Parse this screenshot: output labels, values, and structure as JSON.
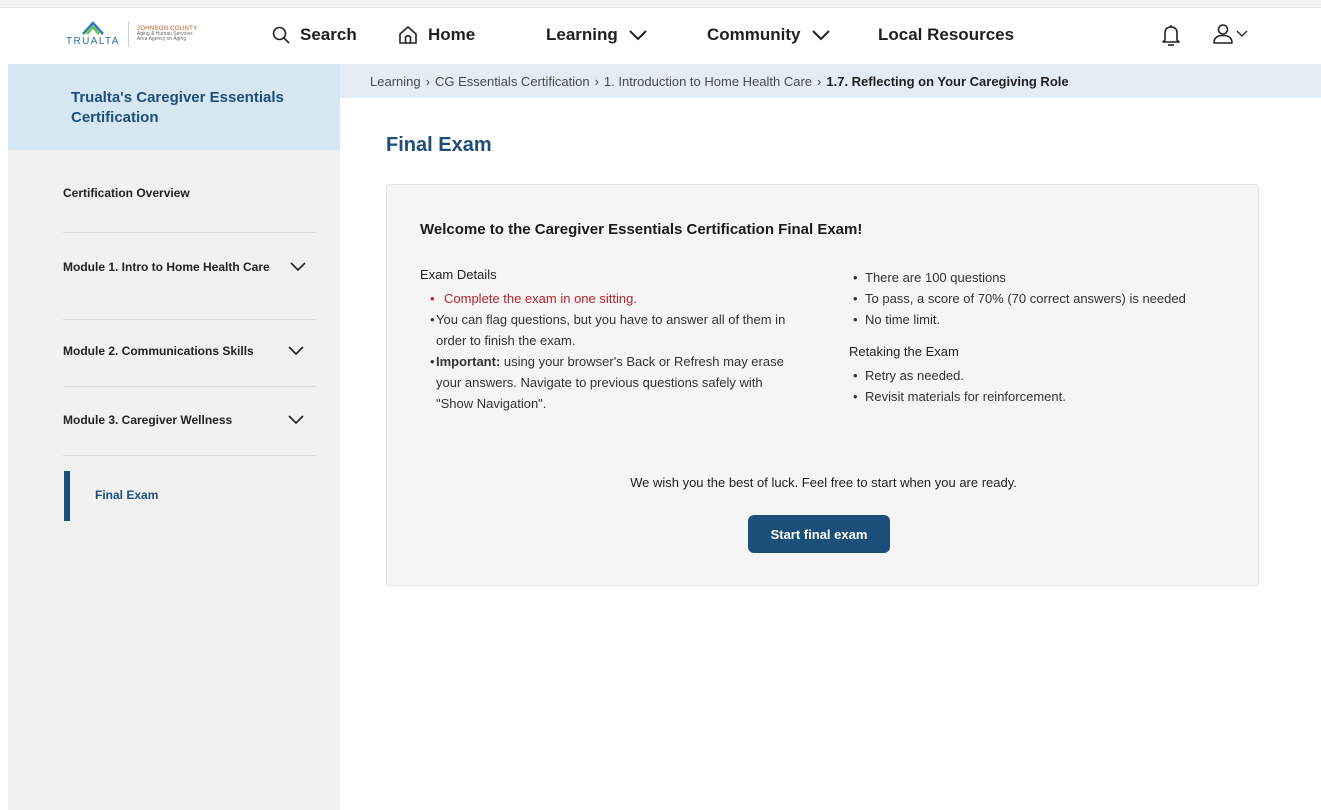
{
  "header": {
    "logo_text": "TRUALTA",
    "county_line1": "JOHNSON COUNTY",
    "county_line2": "Aging & Human Services",
    "county_line3": "Area Agency on Aging",
    "nav": {
      "search": "Search",
      "home": "Home",
      "learning": "Learning",
      "community": "Community",
      "local_resources": "Local Resources"
    }
  },
  "sidebar": {
    "title": "Trualta's Caregiver Essentials Certification",
    "items": [
      {
        "label": "Certification Overview"
      },
      {
        "label": "Module 1. Intro to Home Health Care"
      },
      {
        "label": "Module 2. Communications Skills"
      },
      {
        "label": "Module 3. Caregiver Wellness"
      }
    ],
    "active": "Final Exam"
  },
  "breadcrumb": {
    "items": [
      "Learning",
      "CG Essentials Certification",
      "1. Introduction to Home Health Care"
    ],
    "current": "1.7. Reflecting on Your Caregiving Role"
  },
  "main": {
    "title": "Final Exam",
    "card": {
      "heading": "Welcome to the Caregiver Essentials Certification Final Exam!",
      "exam_details_label": "Exam Details",
      "details": {
        "one_sitting": "Complete the exam in one sitting.",
        "flag": "You can flag questions, but you have to answer all of them in order to finish the exam.",
        "important_label": "Important:",
        "important_text": " using your browser's Back or Refresh may erase your answers. Navigate to previous questions safely with \"Show Navigation\"."
      },
      "right_items": [
        "There are 100 questions",
        "To pass, a score of 70% (70 correct answers) is needed",
        "No time limit."
      ],
      "retaking_label": "Retaking the Exam",
      "retaking_items": [
        "Retry as needed.",
        "Revisit materials for reinforcement."
      ],
      "luck": "We wish you the best of luck. Feel free to start when you are ready.",
      "start_button": "Start final exam"
    }
  },
  "icons": {
    "search": "search-icon",
    "home": "home-icon",
    "chevron": "chevron-down-icon",
    "bell": "bell-icon",
    "user": "user-icon"
  },
  "colors": {
    "brand_blue": "#1d4e79",
    "sidebar_header": "#d6e7f4",
    "breadcrumb_bg": "#e4edf5",
    "alert_red": "#b3232b",
    "button": "#1b4f79"
  }
}
